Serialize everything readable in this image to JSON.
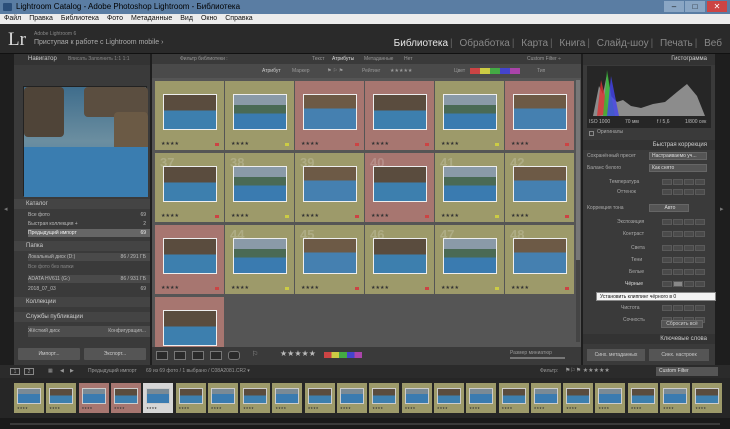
{
  "window": {
    "title": "Lightroom Catalog - Adobe Photoshop Lightroom - Библиотека",
    "min": "–",
    "max": "□",
    "close": "✕"
  },
  "menu": [
    "Файл",
    "Правка",
    "Библиотека",
    "Фото",
    "Метаданные",
    "Вид",
    "Окно",
    "Справка"
  ],
  "identity": {
    "logo": "Lr",
    "version": "Adobe Lightroom 6",
    "message": "Приступая к работе с Lightroom mobile  ›"
  },
  "modules": [
    {
      "label": "Библиотека",
      "active": true
    },
    {
      "label": "Обработка",
      "active": false
    },
    {
      "label": "Карта",
      "active": false
    },
    {
      "label": "Книга",
      "active": false
    },
    {
      "label": "Слайд-шоу",
      "active": false
    },
    {
      "label": "Печать",
      "active": false
    },
    {
      "label": "Веб",
      "active": false
    }
  ],
  "left": {
    "navigator": {
      "title": "Навигатор",
      "opts": "Вписать  Заполнить  1:1  1:1"
    },
    "catalog": {
      "title": "Каталог",
      "rows": [
        {
          "label": "Все фото",
          "count": "69"
        },
        {
          "label": "Быстрая коллекция  +",
          "count": "2"
        },
        {
          "label": "Предыдущий импорт",
          "count": "69"
        }
      ]
    },
    "folders": {
      "title": "Папка",
      "rows": [
        {
          "label": "Локальный диск (D:)",
          "count": "86 / 291 ГБ"
        },
        {
          "label": "Все фото без папки",
          "count": ""
        },
        {
          "label": "ADATA HV611 (G:)",
          "count": "86 / 931 ГБ"
        },
        {
          "label": "2018_07_03",
          "count": "69"
        }
      ]
    },
    "collections": {
      "title": "Коллекции"
    },
    "publish": {
      "title": "Службы публикации",
      "row": "Жёсткий диск",
      "row_btn": "Конфигурация..."
    },
    "import_btn": "Импорт...",
    "export_btn": "Экспорт..."
  },
  "center": {
    "filterbar": {
      "title": "Фильтр библиотеки :",
      "tabs": [
        "Текст",
        "Атрибуты",
        "Метаданные",
        "Нет"
      ],
      "custom": "Custom Filter ÷"
    },
    "attrbar": {
      "attr": "Атрибут",
      "flag": "Маркер",
      "rating": "Рейтинг",
      "color": "Цвет",
      "kind": "Тип"
    },
    "grid_indices": [
      "",
      "",
      "",
      "",
      "",
      "",
      "37",
      "38",
      "39",
      "40",
      "41",
      "42",
      "",
      "44",
      "45",
      "46",
      "47",
      "48",
      "",
      "",
      "",
      "",
      "",
      ""
    ],
    "grid_colors": [
      "y",
      "y",
      "r",
      "r",
      "y",
      "r",
      "y",
      "y",
      "y",
      "r",
      "y",
      "y",
      "r",
      "y",
      "y",
      "y",
      "y",
      "y",
      "r",
      "e",
      "e",
      "e",
      "e",
      "e"
    ],
    "toolbar": {
      "sort": "",
      "size_label": "Размер миниатюр",
      "stars": "★★★★★"
    }
  },
  "right": {
    "histogram": {
      "title": "Гистограмма",
      "iso": "ISO 1000",
      "mm": "70 мм",
      "f": "f / 5,6",
      "s": "1/800 сек",
      "orig": "Оригиналы"
    },
    "quickdev": {
      "title": "Быстрая коррекция"
    },
    "preset": {
      "label": "Сохранённый пресет",
      "value": "Настраиваемо уч..."
    },
    "wb": {
      "label": "Баланс белого",
      "value": "Как снято"
    },
    "temp": "Температура",
    "tint": "Оттенок",
    "tone": {
      "label": "Коррекция тона",
      "auto": "Авто"
    },
    "rows": [
      "Экспозиция",
      "Контраст",
      "Света",
      "Тени",
      "Белые",
      "Чёрные",
      "Чистота",
      "Сочность"
    ],
    "tooltip": "Установить клиппинг чёрного в 0",
    "reset": "Сбросить всё",
    "keywords": "Ключевые слова",
    "sync_meta": "Синх. метаданных",
    "sync_set": "Синх. настроек"
  },
  "filmbar": {
    "page1": "1",
    "page2": "2",
    "source": "Предыдущий импорт",
    "count": "69 из 69 фото  /  1 выбрано  /  C08A2081.CR2  ▾",
    "filter": "Фильтр:",
    "custom": "Custom Filter"
  },
  "colors": {
    "yellow_cell": "#9d9a6a",
    "red_cell": "#a77670",
    "accent": "#5a7da3"
  }
}
